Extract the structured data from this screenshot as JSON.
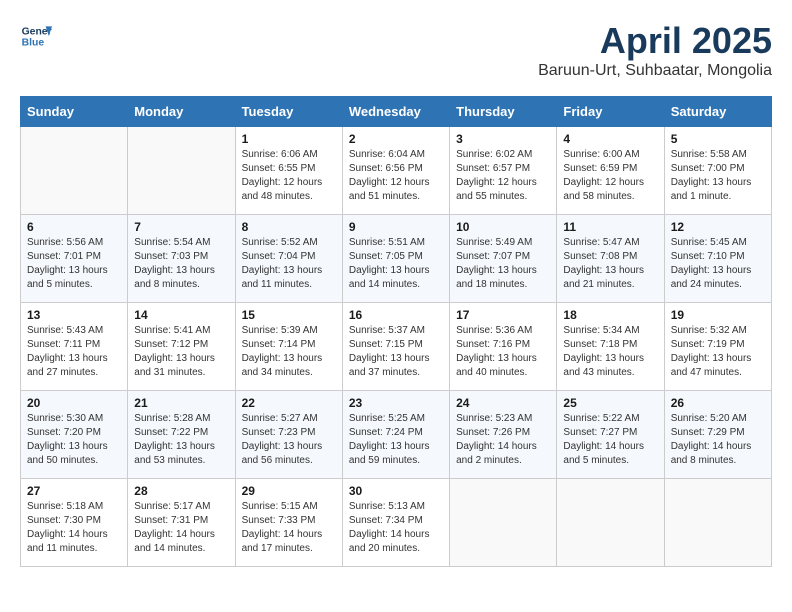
{
  "header": {
    "logo_line1": "General",
    "logo_line2": "Blue",
    "month_year": "April 2025",
    "location": "Baruun-Urt, Suhbaatar, Mongolia"
  },
  "days_of_week": [
    "Sunday",
    "Monday",
    "Tuesday",
    "Wednesday",
    "Thursday",
    "Friday",
    "Saturday"
  ],
  "weeks": [
    [
      {
        "day": "",
        "info": ""
      },
      {
        "day": "",
        "info": ""
      },
      {
        "day": "1",
        "info": "Sunrise: 6:06 AM\nSunset: 6:55 PM\nDaylight: 12 hours\nand 48 minutes."
      },
      {
        "day": "2",
        "info": "Sunrise: 6:04 AM\nSunset: 6:56 PM\nDaylight: 12 hours\nand 51 minutes."
      },
      {
        "day": "3",
        "info": "Sunrise: 6:02 AM\nSunset: 6:57 PM\nDaylight: 12 hours\nand 55 minutes."
      },
      {
        "day": "4",
        "info": "Sunrise: 6:00 AM\nSunset: 6:59 PM\nDaylight: 12 hours\nand 58 minutes."
      },
      {
        "day": "5",
        "info": "Sunrise: 5:58 AM\nSunset: 7:00 PM\nDaylight: 13 hours\nand 1 minute."
      }
    ],
    [
      {
        "day": "6",
        "info": "Sunrise: 5:56 AM\nSunset: 7:01 PM\nDaylight: 13 hours\nand 5 minutes."
      },
      {
        "day": "7",
        "info": "Sunrise: 5:54 AM\nSunset: 7:03 PM\nDaylight: 13 hours\nand 8 minutes."
      },
      {
        "day": "8",
        "info": "Sunrise: 5:52 AM\nSunset: 7:04 PM\nDaylight: 13 hours\nand 11 minutes."
      },
      {
        "day": "9",
        "info": "Sunrise: 5:51 AM\nSunset: 7:05 PM\nDaylight: 13 hours\nand 14 minutes."
      },
      {
        "day": "10",
        "info": "Sunrise: 5:49 AM\nSunset: 7:07 PM\nDaylight: 13 hours\nand 18 minutes."
      },
      {
        "day": "11",
        "info": "Sunrise: 5:47 AM\nSunset: 7:08 PM\nDaylight: 13 hours\nand 21 minutes."
      },
      {
        "day": "12",
        "info": "Sunrise: 5:45 AM\nSunset: 7:10 PM\nDaylight: 13 hours\nand 24 minutes."
      }
    ],
    [
      {
        "day": "13",
        "info": "Sunrise: 5:43 AM\nSunset: 7:11 PM\nDaylight: 13 hours\nand 27 minutes."
      },
      {
        "day": "14",
        "info": "Sunrise: 5:41 AM\nSunset: 7:12 PM\nDaylight: 13 hours\nand 31 minutes."
      },
      {
        "day": "15",
        "info": "Sunrise: 5:39 AM\nSunset: 7:14 PM\nDaylight: 13 hours\nand 34 minutes."
      },
      {
        "day": "16",
        "info": "Sunrise: 5:37 AM\nSunset: 7:15 PM\nDaylight: 13 hours\nand 37 minutes."
      },
      {
        "day": "17",
        "info": "Sunrise: 5:36 AM\nSunset: 7:16 PM\nDaylight: 13 hours\nand 40 minutes."
      },
      {
        "day": "18",
        "info": "Sunrise: 5:34 AM\nSunset: 7:18 PM\nDaylight: 13 hours\nand 43 minutes."
      },
      {
        "day": "19",
        "info": "Sunrise: 5:32 AM\nSunset: 7:19 PM\nDaylight: 13 hours\nand 47 minutes."
      }
    ],
    [
      {
        "day": "20",
        "info": "Sunrise: 5:30 AM\nSunset: 7:20 PM\nDaylight: 13 hours\nand 50 minutes."
      },
      {
        "day": "21",
        "info": "Sunrise: 5:28 AM\nSunset: 7:22 PM\nDaylight: 13 hours\nand 53 minutes."
      },
      {
        "day": "22",
        "info": "Sunrise: 5:27 AM\nSunset: 7:23 PM\nDaylight: 13 hours\nand 56 minutes."
      },
      {
        "day": "23",
        "info": "Sunrise: 5:25 AM\nSunset: 7:24 PM\nDaylight: 13 hours\nand 59 minutes."
      },
      {
        "day": "24",
        "info": "Sunrise: 5:23 AM\nSunset: 7:26 PM\nDaylight: 14 hours\nand 2 minutes."
      },
      {
        "day": "25",
        "info": "Sunrise: 5:22 AM\nSunset: 7:27 PM\nDaylight: 14 hours\nand 5 minutes."
      },
      {
        "day": "26",
        "info": "Sunrise: 5:20 AM\nSunset: 7:29 PM\nDaylight: 14 hours\nand 8 minutes."
      }
    ],
    [
      {
        "day": "27",
        "info": "Sunrise: 5:18 AM\nSunset: 7:30 PM\nDaylight: 14 hours\nand 11 minutes."
      },
      {
        "day": "28",
        "info": "Sunrise: 5:17 AM\nSunset: 7:31 PM\nDaylight: 14 hours\nand 14 minutes."
      },
      {
        "day": "29",
        "info": "Sunrise: 5:15 AM\nSunset: 7:33 PM\nDaylight: 14 hours\nand 17 minutes."
      },
      {
        "day": "30",
        "info": "Sunrise: 5:13 AM\nSunset: 7:34 PM\nDaylight: 14 hours\nand 20 minutes."
      },
      {
        "day": "",
        "info": ""
      },
      {
        "day": "",
        "info": ""
      },
      {
        "day": "",
        "info": ""
      }
    ]
  ]
}
